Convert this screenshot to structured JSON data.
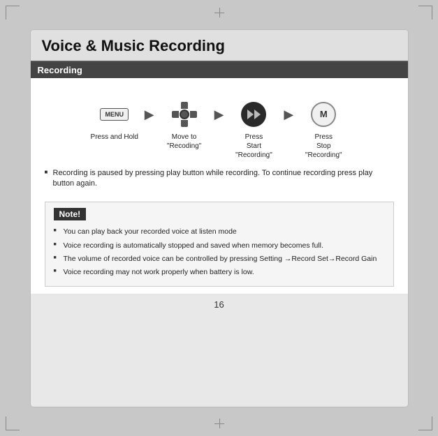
{
  "page": {
    "title": "Voice & Music Recording",
    "page_number": "16"
  },
  "recording_section": {
    "header": "Recording",
    "steps": [
      {
        "id": "step1",
        "icon_type": "menu",
        "label": "Press and Hold"
      },
      {
        "id": "step2",
        "icon_type": "dpad",
        "label": "Move to\n“Recoding”"
      },
      {
        "id": "step3",
        "icon_type": "play",
        "label": "Press\nStart\n“Recording”"
      },
      {
        "id": "step4",
        "icon_type": "m",
        "label": "Press\nStop\n“Recording”"
      }
    ],
    "pause_note": "Recording is paused by pressing play button while recording. To continue recording press play button again.",
    "note_box": {
      "title": "Note!",
      "items": [
        "You can play back your recorded voice at listen mode",
        "Voice recording is automatically stopped and saved when memory becomes full.",
        "The volume of recorded voice can be controlled by pressing Setting →Record Set→Record Gain",
        "Voice recording may not work properly when battery is low."
      ]
    }
  }
}
